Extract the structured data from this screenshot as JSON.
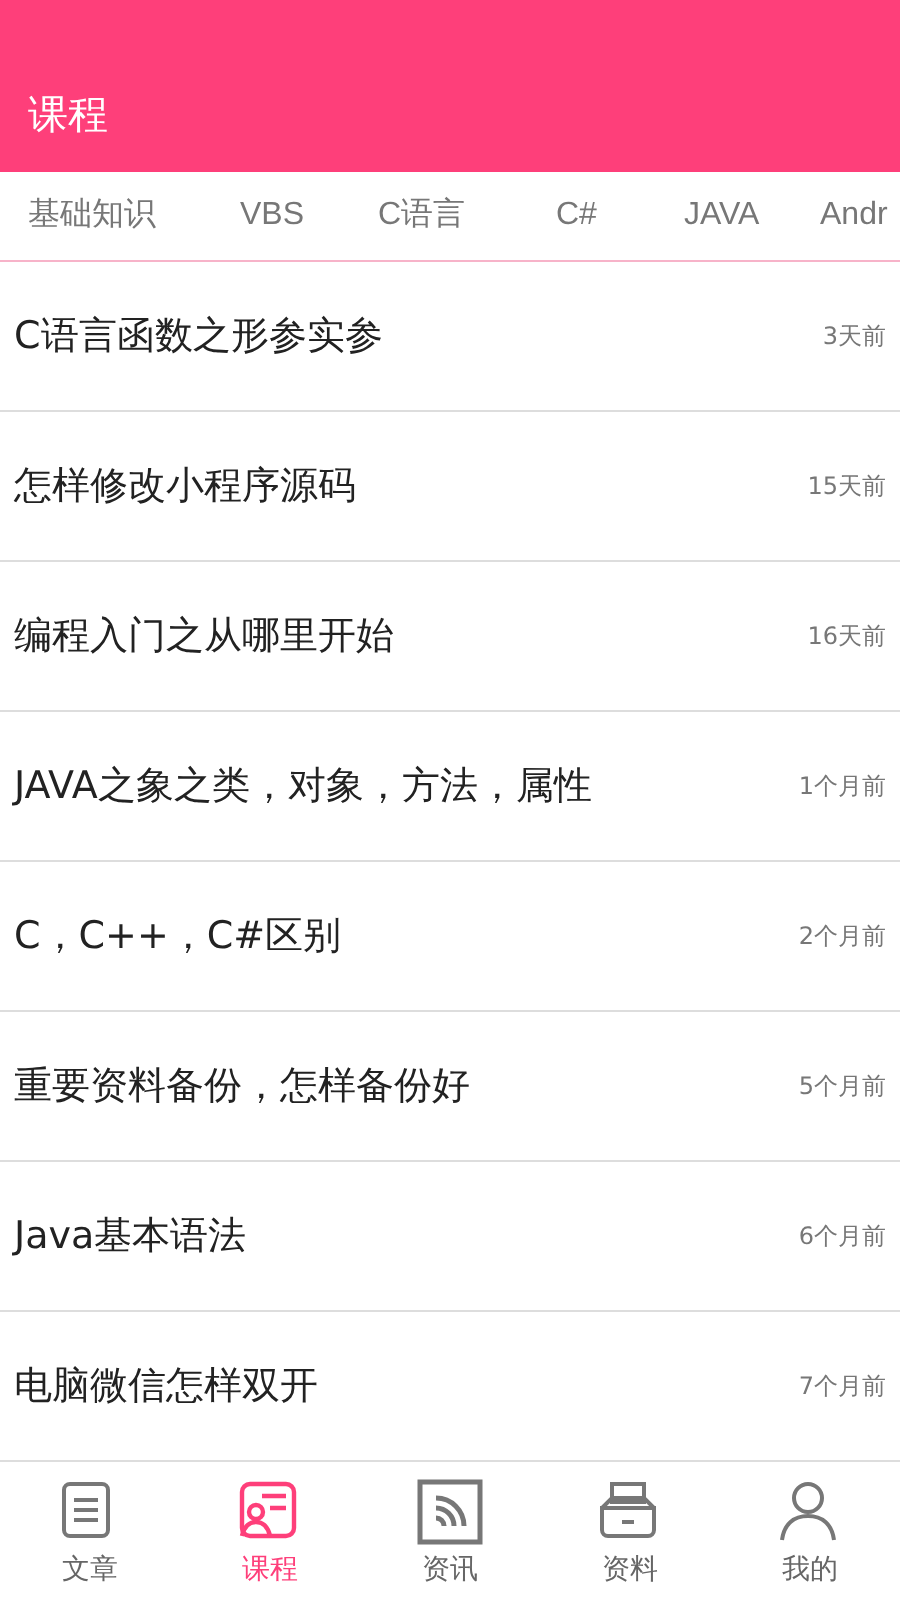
{
  "header": {
    "title": "课程"
  },
  "categories": [
    {
      "label": "基础知识"
    },
    {
      "label": "VBS"
    },
    {
      "label": "C语言"
    },
    {
      "label": "C#"
    },
    {
      "label": "JAVA"
    },
    {
      "label": "Andr"
    }
  ],
  "articles": [
    {
      "title": "C语言函数之形参实参",
      "time": "3天前"
    },
    {
      "title": "怎样修改小程序源码",
      "time": "15天前"
    },
    {
      "title": "编程入门之从哪里开始",
      "time": "16天前"
    },
    {
      "title": "JAVA之象之类，对象，方法，属性",
      "time": "1个月前"
    },
    {
      "title": "C，C++，C#区别",
      "time": "2个月前"
    },
    {
      "title": "重要资料备份，怎样备份好",
      "time": "5个月前"
    },
    {
      "title": "Java基本语法",
      "time": "6个月前"
    },
    {
      "title": "电脑微信怎样双开",
      "time": "7个月前"
    }
  ],
  "bottom_nav": [
    {
      "kind": "article",
      "label": "文章",
      "selected": false
    },
    {
      "kind": "course",
      "label": "课程",
      "selected": true
    },
    {
      "kind": "news",
      "label": "资讯",
      "selected": false
    },
    {
      "kind": "files",
      "label": "资料",
      "selected": false
    },
    {
      "kind": "profile",
      "label": "我的",
      "selected": false
    }
  ]
}
